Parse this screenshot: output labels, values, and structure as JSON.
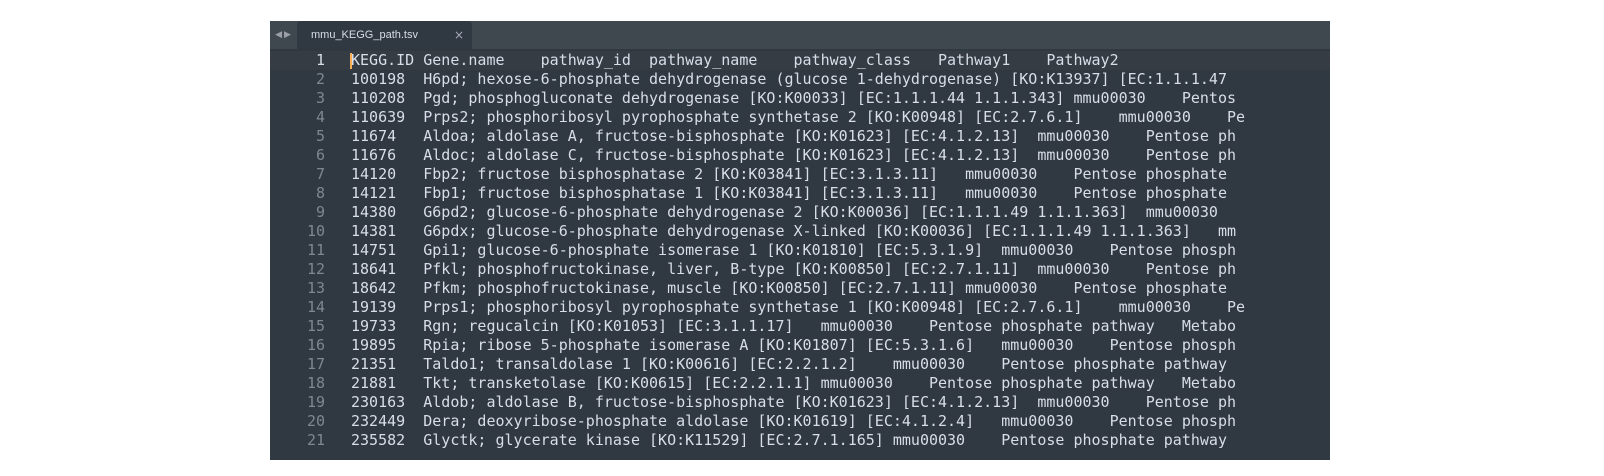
{
  "tab": {
    "title": "mmu_KEGG_path.tsv",
    "close_glyph": "×",
    "nav_left_glyph": "◀",
    "nav_right_glyph": "▶"
  },
  "editor": {
    "current_line": 1,
    "lines": [
      {
        "num": "1",
        "text": "KEGG.ID Gene.name    pathway_id  pathway_name    pathway_class   Pathway1    Pathway2"
      },
      {
        "num": "2",
        "text": "100198  H6pd; hexose-6-phosphate dehydrogenase (glucose 1-dehydrogenase) [KO:K13937] [EC:1.1.1.47"
      },
      {
        "num": "3",
        "text": "110208  Pgd; phosphogluconate dehydrogenase [KO:K00033] [EC:1.1.1.44 1.1.1.343] mmu00030    Pentos"
      },
      {
        "num": "4",
        "text": "110639  Prps2; phosphoribosyl pyrophosphate synthetase 2 [KO:K00948] [EC:2.7.6.1]    mmu00030    Pe"
      },
      {
        "num": "5",
        "text": "11674   Aldoa; aldolase A, fructose-bisphosphate [KO:K01623] [EC:4.1.2.13]  mmu00030    Pentose ph"
      },
      {
        "num": "6",
        "text": "11676   Aldoc; aldolase C, fructose-bisphosphate [KO:K01623] [EC:4.1.2.13]  mmu00030    Pentose ph"
      },
      {
        "num": "7",
        "text": "14120   Fbp2; fructose bisphosphatase 2 [KO:K03841] [EC:3.1.3.11]   mmu00030    Pentose phosphate"
      },
      {
        "num": "8",
        "text": "14121   Fbp1; fructose bisphosphatase 1 [KO:K03841] [EC:3.1.3.11]   mmu00030    Pentose phosphate"
      },
      {
        "num": "9",
        "text": "14380   G6pd2; glucose-6-phosphate dehydrogenase 2 [KO:K00036] [EC:1.1.1.49 1.1.1.363]  mmu00030"
      },
      {
        "num": "10",
        "text": "14381   G6pdx; glucose-6-phosphate dehydrogenase X-linked [KO:K00036] [EC:1.1.1.49 1.1.1.363]   mm"
      },
      {
        "num": "11",
        "text": "14751   Gpi1; glucose-6-phosphate isomerase 1 [KO:K01810] [EC:5.3.1.9]  mmu00030    Pentose phosph"
      },
      {
        "num": "12",
        "text": "18641   Pfkl; phosphofructokinase, liver, B-type [KO:K00850] [EC:2.7.1.11]  mmu00030    Pentose ph"
      },
      {
        "num": "13",
        "text": "18642   Pfkm; phosphofructokinase, muscle [KO:K00850] [EC:2.7.1.11] mmu00030    Pentose phosphate"
      },
      {
        "num": "14",
        "text": "19139   Prps1; phosphoribosyl pyrophosphate synthetase 1 [KO:K00948] [EC:2.7.6.1]    mmu00030    Pe"
      },
      {
        "num": "15",
        "text": "19733   Rgn; regucalcin [KO:K01053] [EC:3.1.1.17]   mmu00030    Pentose phosphate pathway   Metabo"
      },
      {
        "num": "16",
        "text": "19895   Rpia; ribose 5-phosphate isomerase A [KO:K01807] [EC:5.3.1.6]   mmu00030    Pentose phosph"
      },
      {
        "num": "17",
        "text": "21351   Taldo1; transaldolase 1 [KO:K00616] [EC:2.2.1.2]    mmu00030    Pentose phosphate pathway"
      },
      {
        "num": "18",
        "text": "21881   Tkt; transketolase [KO:K00615] [EC:2.2.1.1] mmu00030    Pentose phosphate pathway   Metabo"
      },
      {
        "num": "19",
        "text": "230163  Aldob; aldolase B, fructose-bisphosphate [KO:K01623] [EC:4.1.2.13]  mmu00030    Pentose ph"
      },
      {
        "num": "20",
        "text": "232449  Dera; deoxyribose-phosphate aldolase [KO:K01619] [EC:4.1.2.4]   mmu00030    Pentose phosph"
      },
      {
        "num": "21",
        "text": "235582  Glyctk; glycerate kinase [KO:K11529] [EC:2.7.1.165] mmu00030    Pentose phosphate pathway"
      }
    ]
  }
}
